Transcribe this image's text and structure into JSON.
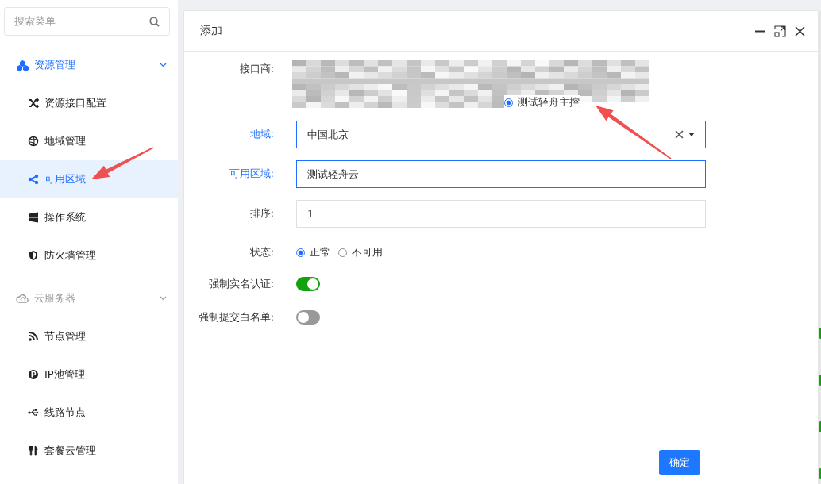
{
  "sidebar": {
    "search": {
      "placeholder": "搜索菜单"
    },
    "groups": [
      {
        "label": "资源管理",
        "active": true,
        "expanded": true,
        "items": [
          {
            "label": "资源接口配置",
            "selected": false
          },
          {
            "label": "地域管理",
            "selected": false
          },
          {
            "label": "可用区域",
            "selected": true
          },
          {
            "label": "操作系统",
            "selected": false
          },
          {
            "label": "防火墙管理",
            "selected": false
          }
        ]
      },
      {
        "label": "云服务器",
        "active": false,
        "expanded": true,
        "items": [
          {
            "label": "节点管理",
            "selected": false
          },
          {
            "label": "IP池管理",
            "selected": false
          },
          {
            "label": "线路节点",
            "selected": false
          },
          {
            "label": "套餐云管理",
            "selected": false
          }
        ]
      }
    ]
  },
  "dialog": {
    "title": "添加",
    "fields": [
      {
        "kind": "provider",
        "label": "接口商:",
        "highlight": false,
        "options": [
          {
            "label": "测试轻舟主控",
            "selected": true
          }
        ]
      },
      {
        "kind": "select",
        "label": "地域:",
        "highlight": true,
        "value": "中国北京",
        "focused": true
      },
      {
        "kind": "input",
        "label": "可用区域:",
        "highlight": true,
        "value": "测试轻舟云",
        "focused": true
      },
      {
        "kind": "input",
        "label": "排序:",
        "highlight": false,
        "value": "1",
        "focused": false
      },
      {
        "kind": "radio",
        "label": "状态:",
        "highlight": false,
        "options": [
          {
            "label": "正常",
            "selected": true
          },
          {
            "label": "不可用",
            "selected": false
          }
        ]
      },
      {
        "kind": "toggle",
        "label": "强制实名认证:",
        "highlight": false,
        "on": true
      },
      {
        "kind": "toggle",
        "label": "强制提交白名单:",
        "highlight": false,
        "on": false
      }
    ],
    "buttons": [
      "确定"
    ]
  }
}
